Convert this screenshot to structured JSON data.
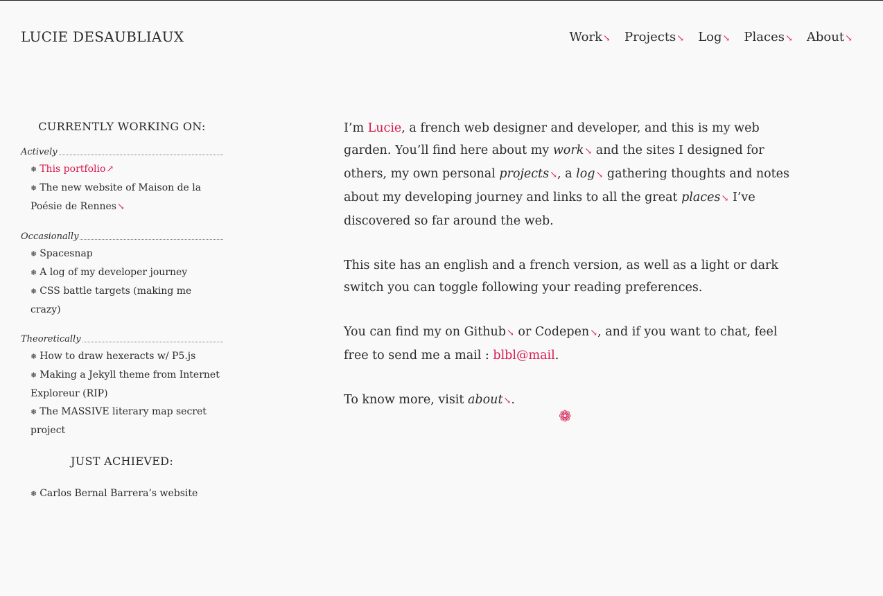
{
  "site": {
    "title": "LUCIE DESAUBLIAUX"
  },
  "nav": [
    {
      "label": "Work"
    },
    {
      "label": "Projects"
    },
    {
      "label": "Log"
    },
    {
      "label": "Places"
    },
    {
      "label": "About"
    }
  ],
  "sidebar": {
    "heading": "CURRENTLY WORKING ON:",
    "groups": [
      {
        "label": "Actively",
        "items": [
          "This portfolio",
          "The new website of Maison de la Poésie de Rennes"
        ]
      },
      {
        "label": "Occasionally",
        "items": [
          "Spacesnap",
          "A log of my developer journey",
          "CSS battle targets (making me crazy)"
        ]
      },
      {
        "label": "Theoretically",
        "items": [
          "How to draw hexeracts w/ P5.js",
          "Making a Jekyll theme from Internet Exploreur (RIP)",
          "The MASSIVE literary map secret project"
        ]
      }
    ],
    "achieved_heading": "JUST ACHIEVED:",
    "achieved": [
      "Carlos Bernal Barrera’s website"
    ]
  },
  "main": {
    "p1": {
      "t1": "I’m ",
      "name": "Lucie",
      "t2": ", a french web designer and developer, and this is my web garden. You’ll find here about my ",
      "work": "work",
      "t3": " and the sites I designed for others, my own personal ",
      "projects": "projects",
      "t4": ", a ",
      "log": "log",
      "t5": " gathering thoughts and notes about my developing journey and links to all the great ",
      "places": "places",
      "t6": " I’ve discovered so far around the web."
    },
    "p2": "This site has an english and a french version, as well as a light or dark switch you can toggle following your reading preferences.",
    "p3": {
      "t1": "You can find my on ",
      "github": "Github",
      "t2": " or ",
      "codepen": "Codepen",
      "t3": ", and if you want to chat, feel free to send me a mail : ",
      "mail": "blbl@mail",
      "t4": "."
    },
    "p4": {
      "t1": "To know more, visit ",
      "about": "about",
      "t2": "."
    }
  },
  "glyphs": {
    "arrow_se": "↘",
    "arrow_ne": "↗",
    "bullet": "❅",
    "flower": "❁"
  },
  "colors": {
    "accent": "#d6194f",
    "background": "#f9f9f9",
    "text": "#2b2b2b"
  }
}
